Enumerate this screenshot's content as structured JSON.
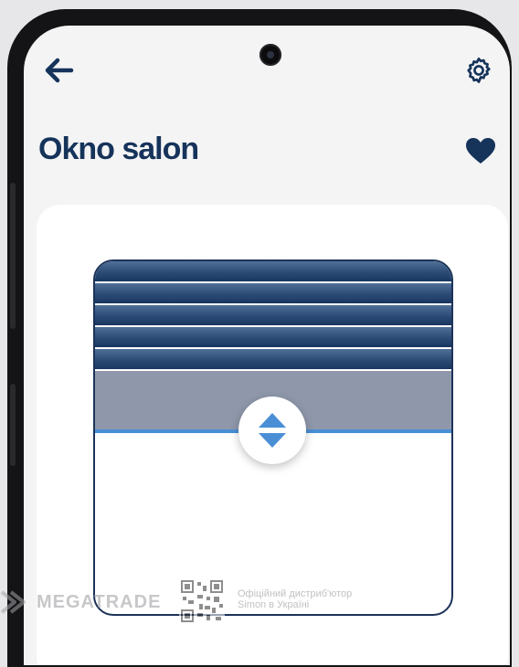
{
  "screen": {
    "title": "Okno salon",
    "is_favorite": true
  },
  "header": {
    "back_icon": "arrow-left-icon",
    "settings_icon": "gear-icon",
    "favorite_icon": "heart-icon"
  },
  "blind": {
    "type": "roller-shutter",
    "position_control_icon": "up-down-arrows-icon"
  },
  "watermark": {
    "brand": "MEGATRADE",
    "line1": "Офіційний дистриб'ютор",
    "line2": "Simon в Україні"
  },
  "colors": {
    "primary_dark_blue": "#16335a",
    "slat_blue": "#2b4b76",
    "accent_light_blue": "#4a8fd6",
    "shade_gray": "#8f98ab",
    "screen_background": "#f4f4f5",
    "card_background": "#ffffff"
  }
}
